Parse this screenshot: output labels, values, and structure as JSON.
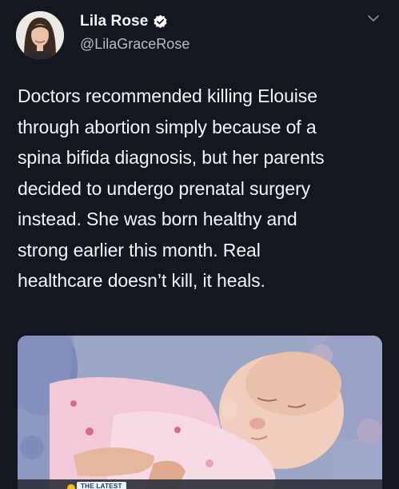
{
  "tweet": {
    "author": {
      "display_name": "Lila Rose",
      "handle": "@LilaGraceRose",
      "verified": true
    },
    "text": "Doctors recommended killing Elouise\nthrough abortion simply because of a\nspina bifida diagnosis, but her parents\ndecided to undergo prenatal surgery\ninstead. She was born healthy and\nstrong earlier this month. Real\nhealthcare doesn’t kill, it heals.",
    "media": {
      "badge_label": "THE LATEST"
    }
  },
  "icons": {
    "verified": "verified-badge-icon",
    "menu": "chevron-down-icon"
  },
  "colors": {
    "background": "#14171f",
    "text": "#f3f4f6",
    "secondary_text": "#b8bcc4",
    "verified_badge": "#ffffff"
  }
}
